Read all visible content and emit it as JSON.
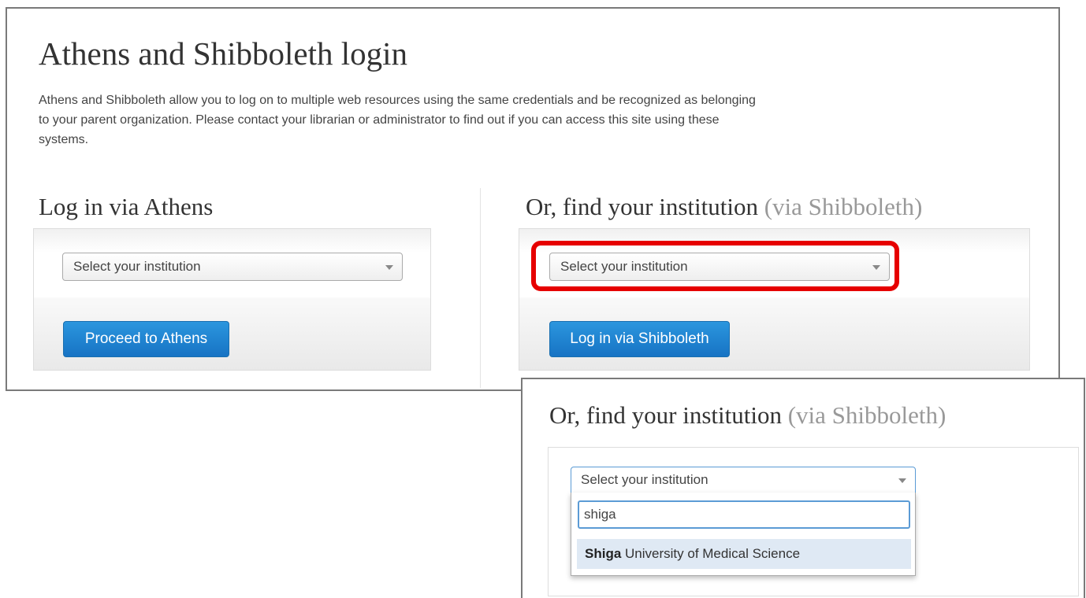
{
  "main": {
    "title": "Athens and Shibboleth login",
    "intro": "Athens and Shibboleth allow you to log on to multiple web resources using the same credentials and be recognized as belonging to your parent organization. Please contact your librarian or administrator to find out if you can access this site using these systems.",
    "athens": {
      "heading": "Log in via Athens",
      "select_placeholder": "Select your institution",
      "button_label": "Proceed to Athens"
    },
    "shibboleth": {
      "heading": "Or, find your institution",
      "heading_suffix": "(via Shibboleth)",
      "select_placeholder": "Select your institution",
      "button_label": "Log in via Shibboleth"
    }
  },
  "zoom": {
    "heading": "Or, find your institution",
    "heading_suffix": "(via Shibboleth)",
    "select_placeholder": "Select your institution",
    "search_value": "shiga",
    "option_match": "Shiga",
    "option_rest": " University of Medical Science"
  },
  "colors": {
    "highlight": "#e60000",
    "button": "#1e80cf",
    "focus": "#5b9bd5"
  },
  "icons": [
    "chevron-down-icon"
  ]
}
